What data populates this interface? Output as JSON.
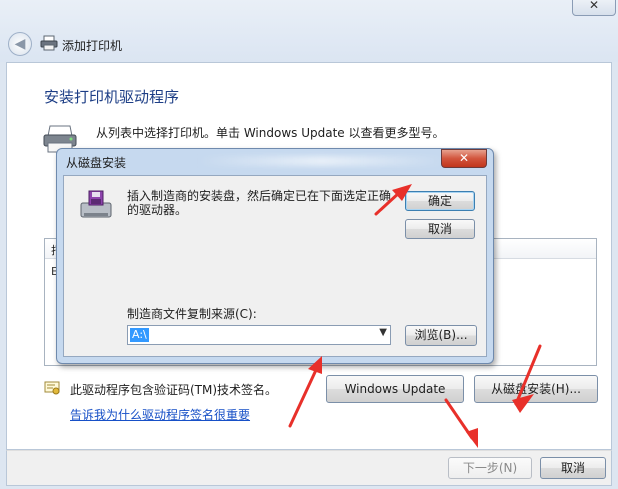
{
  "window": {
    "title": "添加打印机",
    "close_glyph": "✕",
    "back_glyph": "◀"
  },
  "page": {
    "heading": "安装打印机驱动程序",
    "instruction": "从列表中选择打印机。单击 Windows Update 以查看更多型号。",
    "list_header_char": "打",
    "list_item_char": "E",
    "cert_text": "此驱动程序包含验证码(TM)技术签名。",
    "link_text": "告诉我为什么驱动程序签名很重要",
    "windows_update_button": "Windows Update",
    "have_disk_button": "从磁盘安装(H)...",
    "next_button": "下一步(N)",
    "cancel_button": "取消"
  },
  "dialog": {
    "title": "从磁盘安装",
    "close_glyph": "✕",
    "message": "插入制造商的安装盘，然后确定已在下面选定正确的驱动器。",
    "ok_button": "确定",
    "cancel_button": "取消",
    "source_label": "制造商文件复制来源(C):",
    "source_value": "A:\\",
    "browse_button": "浏览(B)...",
    "dropdown_glyph": "▼"
  },
  "colors": {
    "heading": "#1d3e86",
    "link": "#1750c7",
    "arrow": "#e8302a",
    "dialog_frame": "#c6d9ef",
    "close_red": "#c1361d"
  },
  "icons": [
    "back-icon",
    "printer-icon",
    "printer-large-icon",
    "disk-install-icon",
    "certificate-icon",
    "chevron-down-icon",
    "close-icon"
  ]
}
